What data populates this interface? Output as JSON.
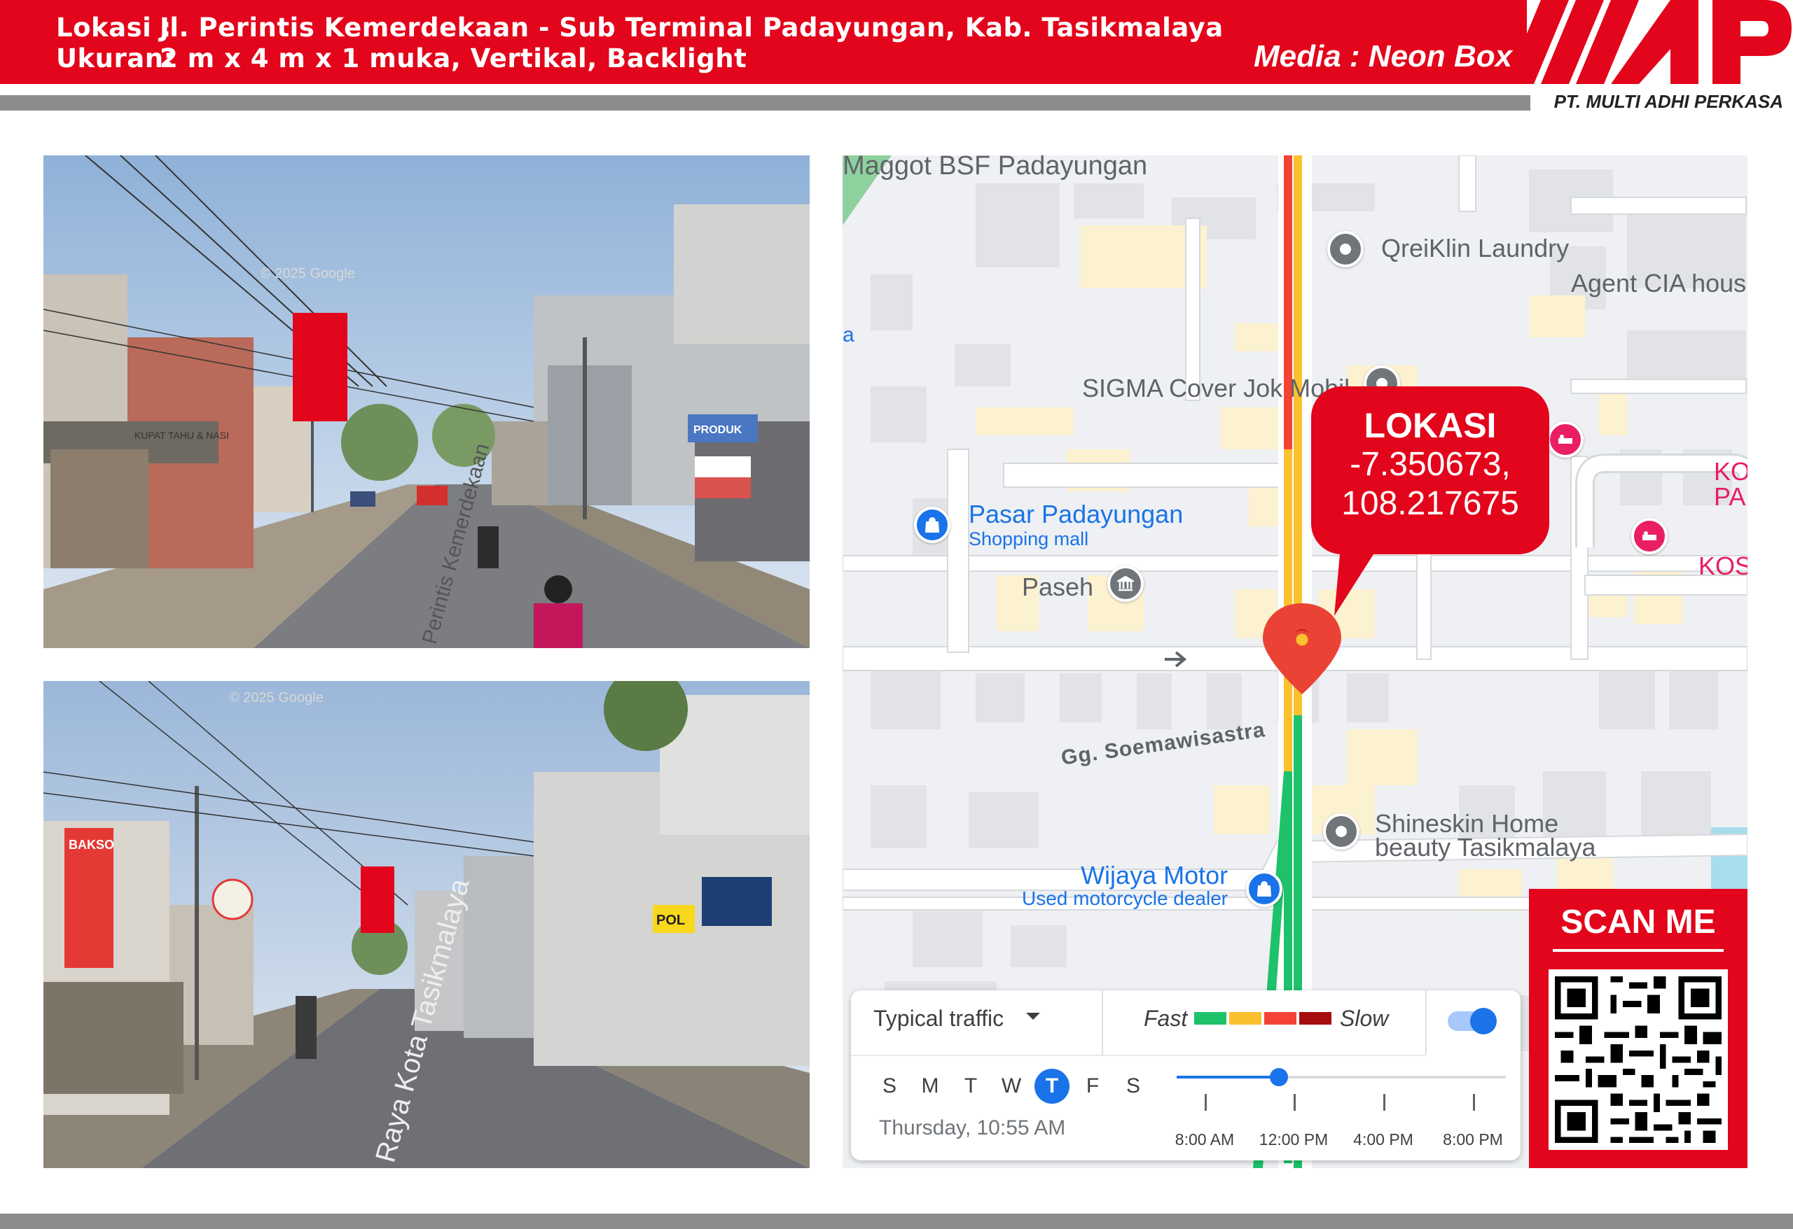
{
  "header": {
    "lokasi_label": "Lokasi  :",
    "lokasi_value": "Jl. Perintis Kemerdekaan - Sub Terminal Padayungan, Kab. Tasikmalaya",
    "ukuran_label": "Ukuran:",
    "ukuran_value": "2 m x 4 m x 1 muka, Vertikal, Backlight",
    "media": "Media : Neon Box",
    "logo_text": "MAP",
    "company": "PT. MULTI ADHI PERKASA"
  },
  "photos": [
    {
      "watermark": "© 2025 Google",
      "road_text": "Perintis Kemerdekaan",
      "shop_signs": [
        "KUPAT TAHU & NASI",
        "PRODUK"
      ]
    },
    {
      "watermark": "© 2025 Google",
      "road_text": "Raya Kota Tasikmalaya",
      "shop_signs": [
        "BAKSO",
        "POL"
      ]
    }
  ],
  "map": {
    "places": [
      {
        "name": "Maggot BSF Padayungan",
        "sub": "",
        "icon": "none"
      },
      {
        "name": "QreiKlin Laundry",
        "sub": "",
        "icon": "pin-grey"
      },
      {
        "name": "Agent CIA hous",
        "sub": "",
        "icon": "none"
      },
      {
        "name": "SIGMA Cover Jok Mobil",
        "sub": "",
        "icon": "pin-grey"
      },
      {
        "name": "Pasar Padayungan",
        "sub": "Shopping mall",
        "icon": "shopping-bag-blue"
      },
      {
        "name": "Paseh",
        "sub": "",
        "icon": "landmark-grey"
      },
      {
        "name": "Gg. Soemawisastra",
        "sub": "",
        "icon": "none"
      },
      {
        "name": "Shineskin Home",
        "sub": "beauty Tasikmalaya",
        "icon": "pin-grey"
      },
      {
        "name": "Wijaya Motor",
        "sub": "Used motorcycle dealer",
        "icon": "shopping-bag-blue"
      },
      {
        "name": "KO",
        "sub": "PA",
        "icon": "hotel-pink"
      },
      {
        "name": "KOS",
        "sub": "",
        "icon": "hotel-pink"
      },
      {
        "name": "a",
        "sub": "",
        "icon": "none"
      }
    ],
    "callout": {
      "title": "LOKASI",
      "lat": "-7.350673,",
      "lng": "108.217675"
    },
    "colors": {
      "fast": "#1ec26b",
      "moderate": "#fbc02d",
      "slow": "#f44336",
      "very_slow": "#a50e0e",
      "accent": "#e3051b"
    }
  },
  "traffic": {
    "mode": "Typical traffic",
    "fast_label": "Fast",
    "slow_label": "Slow",
    "toggle_on": true,
    "days": [
      "S",
      "M",
      "T",
      "W",
      "T",
      "F",
      "S"
    ],
    "active_day_index": 4,
    "time_display": "Thursday, 10:55 AM",
    "slider_fraction": 0.31,
    "ticks": [
      "8:00 AM",
      "12:00 PM",
      "4:00 PM",
      "8:00 PM"
    ]
  },
  "scan": {
    "title": "SCAN ME"
  }
}
